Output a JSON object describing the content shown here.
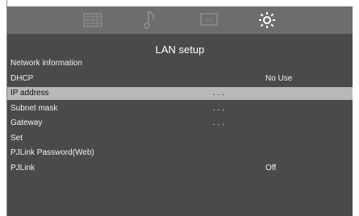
{
  "screen": {
    "title": "LAN setup",
    "tabs": [
      {
        "icon": "picture-grid-icon"
      },
      {
        "icon": "audio-note-icon"
      },
      {
        "icon": "tv-icon"
      },
      {
        "icon": "settings-gear-icon",
        "active": true
      }
    ]
  },
  "menu": {
    "items": [
      {
        "label": "Network information",
        "value": ""
      },
      {
        "label": "DHCP",
        "value": "No Use"
      },
      {
        "label": "IP address",
        "value": ". . ."
      },
      {
        "label": "Subnet mask",
        "value": ". . ."
      },
      {
        "label": "Gateway",
        "value": ". . ."
      },
      {
        "label": "Set",
        "value": ""
      },
      {
        "label": "PJLink Password(Web)",
        "value": ""
      },
      {
        "label": "PJLink",
        "value": "Off"
      }
    ]
  },
  "colors": {
    "background": "#4a4a4a",
    "topbar": "#6d6d6d",
    "selected_row": "#b8b8b8",
    "text": "#f2f2f2"
  }
}
